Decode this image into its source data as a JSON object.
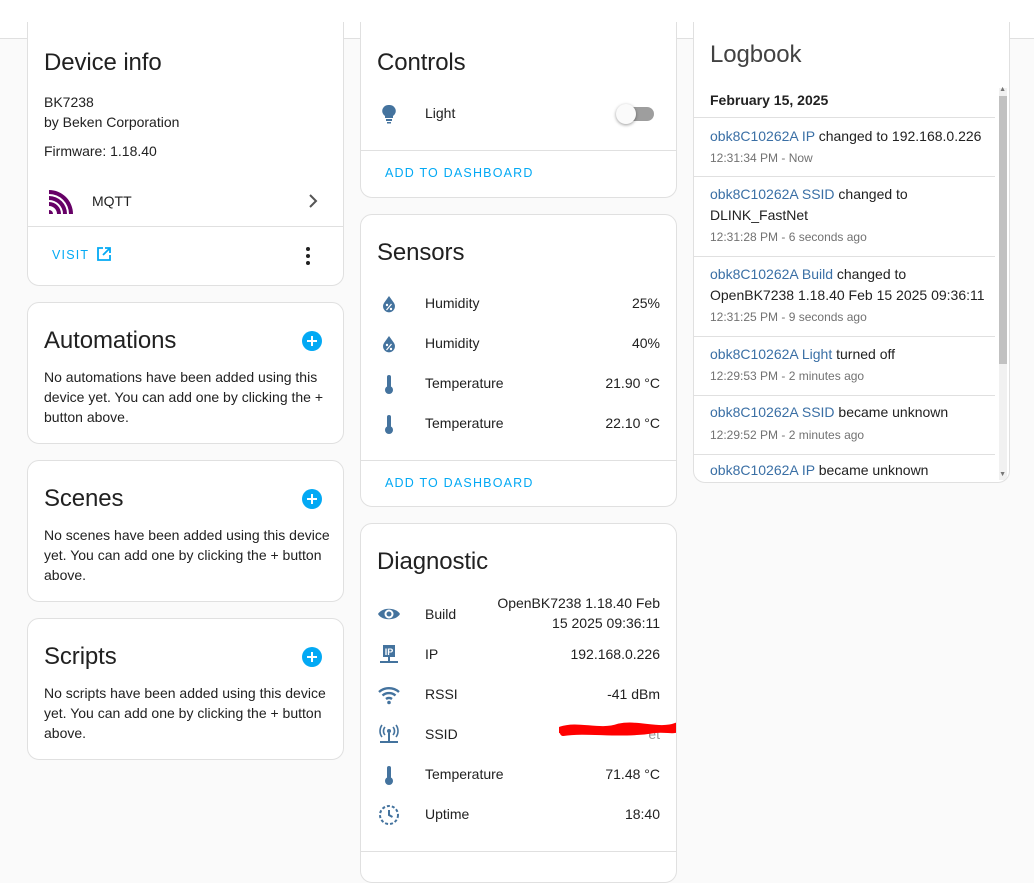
{
  "device_info": {
    "title": "Device info",
    "model": "BK7238",
    "manufacturer": "by Beken Corporation",
    "firmware": "Firmware: 1.18.40",
    "integration_label": "MQTT",
    "visit_label": "VISIT"
  },
  "automations": {
    "title": "Automations",
    "text": "No automations have been added using this device yet. You can add one by clicking the + button above."
  },
  "scenes": {
    "title": "Scenes",
    "text": "No scenes have been added using this device yet. You can add one by clicking the + button above."
  },
  "scripts": {
    "title": "Scripts",
    "text": "No scripts have been added using this device yet. You can add one by clicking the + button above."
  },
  "controls": {
    "title": "Controls",
    "light_label": "Light",
    "light_on": false,
    "add_label": "ADD TO DASHBOARD"
  },
  "sensors": {
    "title": "Sensors",
    "rows": [
      {
        "icon": "water-percent-icon",
        "label": "Humidity",
        "value": "25%"
      },
      {
        "icon": "water-percent-icon",
        "label": "Humidity",
        "value": "40%"
      },
      {
        "icon": "thermometer-icon",
        "label": "Temperature",
        "value": "21.90 °C"
      },
      {
        "icon": "thermometer-icon",
        "label": "Temperature",
        "value": "22.10 °C"
      }
    ],
    "add_label": "ADD TO DASHBOARD"
  },
  "diagnostic": {
    "title": "Diagnostic",
    "build_label": "Build",
    "build_value_line1": "OpenBK7238 1.18.40 Feb",
    "build_value_line2": "15 2025 09:36:11",
    "ip_label": "IP",
    "ip_value": "192.168.0.226",
    "rssi_label": "RSSI",
    "rssi_value": "-41 dBm",
    "ssid_label": "SSID",
    "ssid_value_visible": "et",
    "temp_label": "Temperature",
    "temp_value": "71.48 °C",
    "uptime_label": "Uptime",
    "uptime_value": "18:40"
  },
  "logbook": {
    "title": "Logbook",
    "date": "February 15, 2025",
    "entries": [
      {
        "entity": "obk8C10262A IP",
        "text": " changed to 192.168.0.226",
        "time": "12:31:34 PM - Now"
      },
      {
        "entity": "obk8C10262A SSID",
        "text": " changed to DLINK_FastNet",
        "time": "12:31:28 PM - 6 seconds ago"
      },
      {
        "entity": "obk8C10262A Build",
        "text": " changed to OpenBK7238 1.18.40 Feb 15 2025 09:36:11",
        "time": "12:31:25 PM - 9 seconds ago"
      },
      {
        "entity": "obk8C10262A Light",
        "text": " turned off",
        "time": "12:29:53 PM - 2 minutes ago"
      },
      {
        "entity": "obk8C10262A SSID",
        "text": " became unknown",
        "time": "12:29:52 PM - 2 minutes ago"
      },
      {
        "entity": "obk8C10262A IP",
        "text": " became unknown",
        "time": ""
      }
    ]
  },
  "colors": {
    "accent": "#03a9f4",
    "icon": "#44739e",
    "mqtt": "#660066",
    "redaction": "#ff0000"
  }
}
